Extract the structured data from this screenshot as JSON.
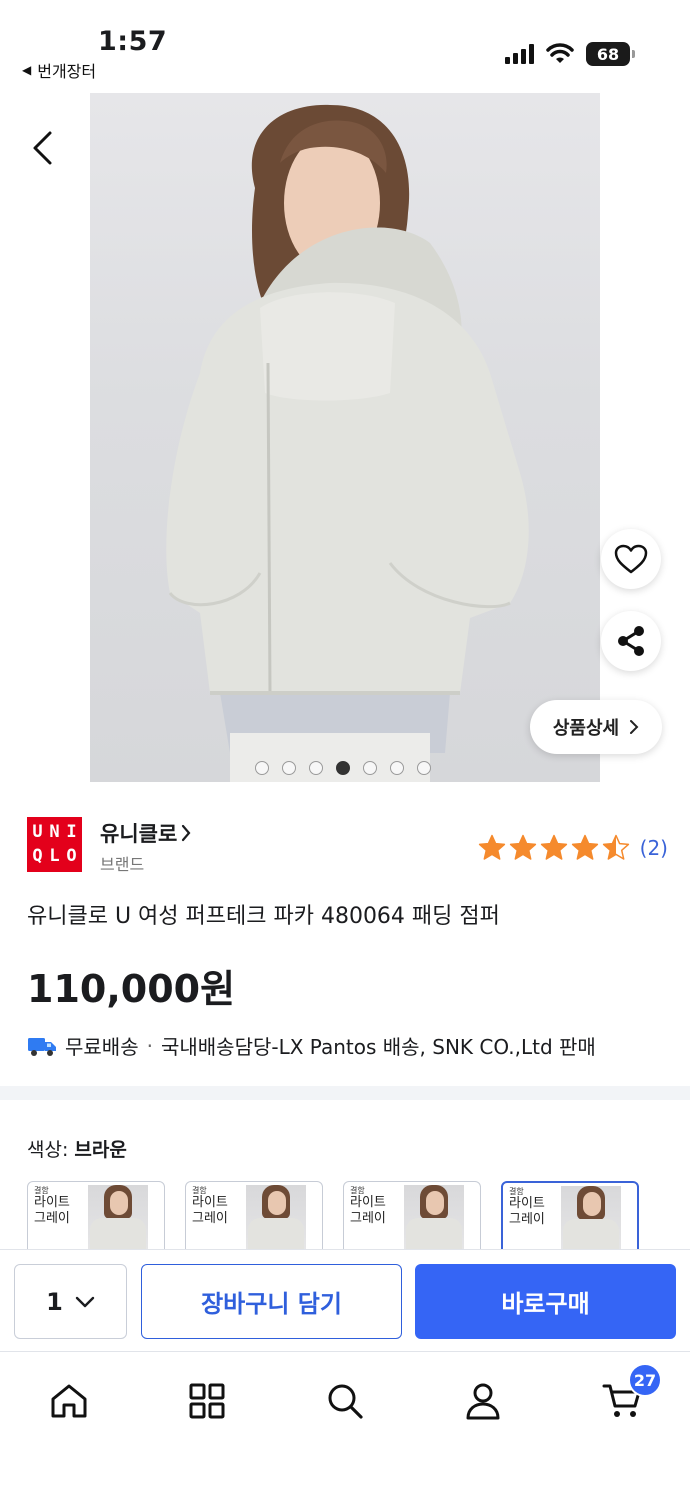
{
  "status_bar": {
    "time": "1:57",
    "back_app": "번개장터",
    "battery": "68"
  },
  "product": {
    "image_dots_count": 7,
    "image_active_index": 3,
    "detail_button": "상품상세",
    "brand_logo_letters": [
      "U",
      "N",
      "I",
      "Q",
      "L",
      "O"
    ],
    "brand_name": "유니클로",
    "brand_type": "브랜드",
    "rating": {
      "value": 4.5,
      "max": 5,
      "count": "(2)"
    },
    "title": "유니클로 U 여성 퍼프테크 파카 480064 패딩 점퍼",
    "price": "110,000원",
    "shipping": {
      "free": "무료배송",
      "separator": "·",
      "detail": "국내배송담당-LX Pantos 배송, SNK CO.,Ltd 판매"
    }
  },
  "options": {
    "color_label": "색상:",
    "color_value": "브라운",
    "swatches": [
      {
        "tag": "결함",
        "text": "라이트 그레이",
        "selected": false
      },
      {
        "tag": "결함",
        "text": "라이트 그레이",
        "selected": false
      },
      {
        "tag": "결함",
        "text": "라이트 그레이",
        "selected": false
      },
      {
        "tag": "결함",
        "text": "라이트 그레이",
        "selected": true
      }
    ]
  },
  "action_bar": {
    "quantity": "1",
    "add_to_cart": "장바구니 담기",
    "buy_now": "바로구매"
  },
  "tab_bar": {
    "cart_badge": "27"
  },
  "colors": {
    "accent": "#3565f5",
    "brand_red": "#e3001b",
    "star": "#f58a2d"
  }
}
